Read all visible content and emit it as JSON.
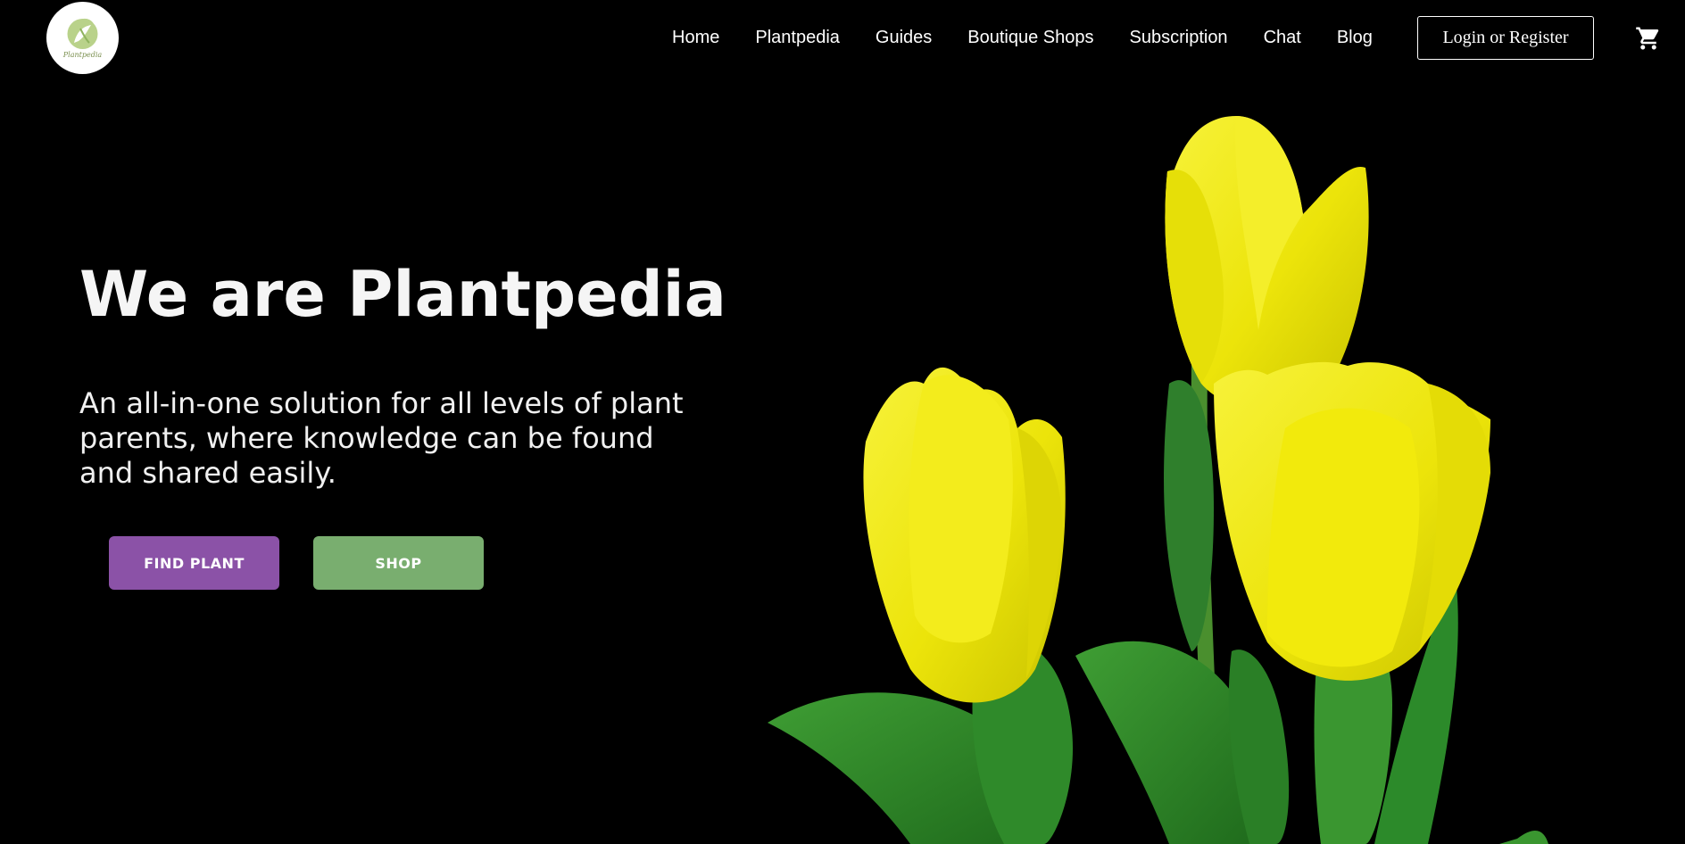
{
  "header": {
    "logo": {
      "text": "Plantpedia",
      "icon": "plantpedia-logo-icon"
    },
    "nav": [
      {
        "label": "Home"
      },
      {
        "label": "Plantpedia"
      },
      {
        "label": "Guides"
      },
      {
        "label": "Boutique Shops"
      },
      {
        "label": "Subscription"
      },
      {
        "label": "Chat"
      },
      {
        "label": "Blog"
      }
    ],
    "login_label": "Login or Register",
    "cart_icon": "shopping-cart-icon"
  },
  "hero": {
    "title": "We are Plantpedia",
    "subtitle": "An all-in-one solution for all levels of plant parents, where knowledge can be found and shared easily.",
    "buttons": {
      "find_plant": "FIND PLANT",
      "shop": "SHOP"
    },
    "image": "yellow-tulips-image"
  },
  "colors": {
    "background": "#000000",
    "find_plant_button": "#8b52a7",
    "shop_button": "#79ae6f",
    "tulip_yellow": "#f2ea0a",
    "leaf_green": "#2f8a2a"
  }
}
